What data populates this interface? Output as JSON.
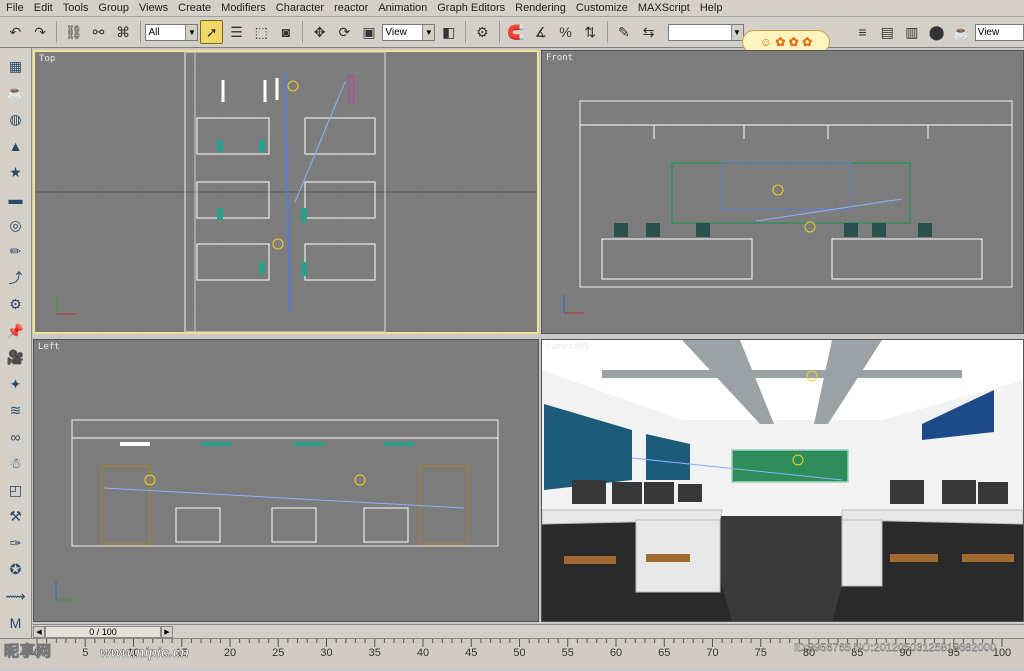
{
  "menu": [
    "File",
    "Edit",
    "Tools",
    "Group",
    "Views",
    "Create",
    "Modifiers",
    "Character",
    "reactor",
    "Animation",
    "Graph Editors",
    "Rendering",
    "Customize",
    "MAXScript",
    "Help"
  ],
  "toolbar": {
    "selection_filter": "All",
    "reference_coord": "View",
    "reference_coord_right": "View"
  },
  "viewports": {
    "top": "Top",
    "front": "Front",
    "left": "Left",
    "camera": "Camera01"
  },
  "time_slider": "0 / 100",
  "track_ticks": [
    "0",
    "5",
    "10",
    "15",
    "20",
    "25",
    "30",
    "35",
    "40",
    "45",
    "50",
    "55",
    "60",
    "65",
    "70",
    "75",
    "80",
    "85",
    "90",
    "95",
    "100"
  ],
  "watermark": {
    "brand": "昵享网",
    "url": "www.nipic.cn",
    "id": "ID:8956765 NO:20120503125818682000"
  },
  "colors": {
    "ui_gray": "#d4d0c8",
    "viewport_bg": "#7c7c7c",
    "active_border": "#f0e38a",
    "wire_white": "#ffffff",
    "wire_teal": "#2aa08a",
    "wire_blue": "#5a7ad8",
    "board_green": "#2e8e5a"
  }
}
